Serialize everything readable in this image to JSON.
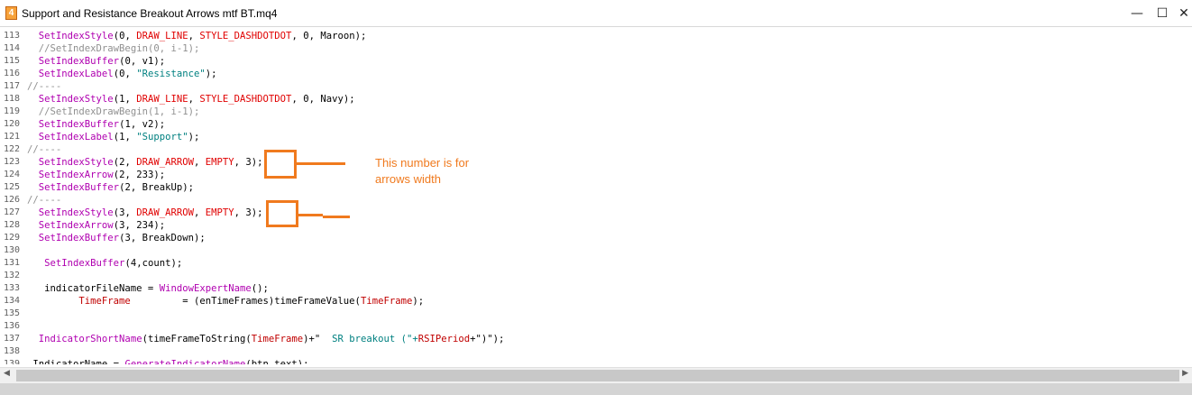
{
  "window": {
    "title": "Support and Resistance Breakout Arrows mtf BT.mq4",
    "app_icon_glyph": "4",
    "minimize_glyph": "—",
    "maximize_glyph": "☐",
    "close_glyph": "✕"
  },
  "code_lines": [
    {
      "num": "113",
      "tokens": [
        {
          "t": "  "
        },
        {
          "t": "SetIndexStyle",
          "c": "fn"
        },
        {
          "t": "(0, "
        },
        {
          "t": "DRAW_LINE",
          "c": "kw"
        },
        {
          "t": ", "
        },
        {
          "t": "STYLE_DASHDOTDOT",
          "c": "kw"
        },
        {
          "t": ", 0, Maroon);"
        }
      ]
    },
    {
      "num": "114",
      "tokens": [
        {
          "t": "  "
        },
        {
          "t": "//SetIndexDrawBegin(0, i-1);",
          "c": "cm"
        }
      ]
    },
    {
      "num": "115",
      "tokens": [
        {
          "t": "  "
        },
        {
          "t": "SetIndexBuffer",
          "c": "fn"
        },
        {
          "t": "(0, v1);"
        }
      ]
    },
    {
      "num": "116",
      "tokens": [
        {
          "t": "  "
        },
        {
          "t": "SetIndexLabel",
          "c": "fn"
        },
        {
          "t": "(0, "
        },
        {
          "t": "\"Resistance\"",
          "c": "str"
        },
        {
          "t": ");"
        }
      ]
    },
    {
      "num": "117",
      "tokens": [
        {
          "t": "//----",
          "c": "cm"
        }
      ]
    },
    {
      "num": "118",
      "tokens": [
        {
          "t": "  "
        },
        {
          "t": "SetIndexStyle",
          "c": "fn"
        },
        {
          "t": "(1, "
        },
        {
          "t": "DRAW_LINE",
          "c": "kw"
        },
        {
          "t": ", "
        },
        {
          "t": "STYLE_DASHDOTDOT",
          "c": "kw"
        },
        {
          "t": ", 0, Navy);"
        }
      ]
    },
    {
      "num": "119",
      "tokens": [
        {
          "t": "  "
        },
        {
          "t": "//SetIndexDrawBegin(1, i-1);",
          "c": "cm"
        }
      ]
    },
    {
      "num": "120",
      "tokens": [
        {
          "t": "  "
        },
        {
          "t": "SetIndexBuffer",
          "c": "fn"
        },
        {
          "t": "(1, v2);"
        }
      ]
    },
    {
      "num": "121",
      "tokens": [
        {
          "t": "  "
        },
        {
          "t": "SetIndexLabel",
          "c": "fn"
        },
        {
          "t": "(1, "
        },
        {
          "t": "\"Support\"",
          "c": "str"
        },
        {
          "t": ");"
        }
      ]
    },
    {
      "num": "122",
      "tokens": [
        {
          "t": "//----",
          "c": "cm"
        }
      ]
    },
    {
      "num": "123",
      "tokens": [
        {
          "t": "  "
        },
        {
          "t": "SetIndexStyle",
          "c": "fn"
        },
        {
          "t": "(2, "
        },
        {
          "t": "DRAW_ARROW",
          "c": "kw"
        },
        {
          "t": ", "
        },
        {
          "t": "EMPTY",
          "c": "kw"
        },
        {
          "t": ", 3);"
        }
      ]
    },
    {
      "num": "124",
      "tokens": [
        {
          "t": "  "
        },
        {
          "t": "SetIndexArrow",
          "c": "fn"
        },
        {
          "t": "(2, 233);"
        }
      ]
    },
    {
      "num": "125",
      "tokens": [
        {
          "t": "  "
        },
        {
          "t": "SetIndexBuffer",
          "c": "fn"
        },
        {
          "t": "(2, BreakUp);"
        }
      ]
    },
    {
      "num": "126",
      "tokens": [
        {
          "t": "//----",
          "c": "cm"
        }
      ]
    },
    {
      "num": "127",
      "tokens": [
        {
          "t": "  "
        },
        {
          "t": "SetIndexStyle",
          "c": "fn"
        },
        {
          "t": "(3, "
        },
        {
          "t": "DRAW_ARROW",
          "c": "kw"
        },
        {
          "t": ", "
        },
        {
          "t": "EMPTY",
          "c": "kw"
        },
        {
          "t": ", 3);"
        }
      ]
    },
    {
      "num": "128",
      "tokens": [
        {
          "t": "  "
        },
        {
          "t": "SetIndexArrow",
          "c": "fn"
        },
        {
          "t": "(3, 234);"
        }
      ]
    },
    {
      "num": "129",
      "tokens": [
        {
          "t": "  "
        },
        {
          "t": "SetIndexBuffer",
          "c": "fn"
        },
        {
          "t": "(3, BreakDown);"
        }
      ]
    },
    {
      "num": "130",
      "tokens": [
        {
          "t": ""
        }
      ]
    },
    {
      "num": "131",
      "tokens": [
        {
          "t": "   "
        },
        {
          "t": "SetIndexBuffer",
          "c": "fn"
        },
        {
          "t": "(4,count);"
        }
      ]
    },
    {
      "num": "132",
      "tokens": [
        {
          "t": ""
        }
      ]
    },
    {
      "num": "133",
      "tokens": [
        {
          "t": "   indicatorFileName = "
        },
        {
          "t": "WindowExpertName",
          "c": "fn"
        },
        {
          "t": "();"
        }
      ]
    },
    {
      "num": "134",
      "tokens": [
        {
          "t": "         "
        },
        {
          "t": "TimeFrame",
          "c": "id"
        },
        {
          "t": "         = (enTimeFrames)timeFrameValue("
        },
        {
          "t": "TimeFrame",
          "c": "id"
        },
        {
          "t": ");"
        }
      ]
    },
    {
      "num": "135",
      "tokens": [
        {
          "t": ""
        }
      ]
    },
    {
      "num": "136",
      "tokens": [
        {
          "t": ""
        }
      ]
    },
    {
      "num": "137",
      "tokens": [
        {
          "t": "  "
        },
        {
          "t": "IndicatorShortName",
          "c": "fn"
        },
        {
          "t": "(timeFrameToString("
        },
        {
          "t": "TimeFrame",
          "c": "id"
        },
        {
          "t": ")+\"  "
        },
        {
          "t": "SR breakout (\"+",
          "c": "str"
        },
        {
          "t": "RSIPeriod",
          "c": "id"
        },
        {
          "t": "+\")\");"
        }
      ]
    },
    {
      "num": "138",
      "tokens": [
        {
          "t": ""
        }
      ]
    },
    {
      "num": "139",
      "tokens": [
        {
          "t": " IndicatorName = "
        },
        {
          "t": "GenerateIndicatorName",
          "c": "fn"
        },
        {
          "t": "(btn_text);"
        }
      ]
    }
  ],
  "annotation": {
    "note_line1": "This number is for",
    "note_line2": "arrows width",
    "color": "#f07a1e"
  },
  "scrollbar": {
    "left_glyph": "◀",
    "right_glyph": "▶"
  }
}
